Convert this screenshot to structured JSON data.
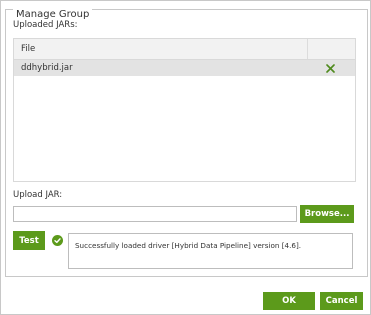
{
  "dialog": {
    "title": "Manage Group",
    "uploaded_label": "Uploaded JARs:",
    "table": {
      "columns": [
        "File",
        ""
      ],
      "rows": [
        {
          "file": "ddhybrid.jar",
          "action_icon": "delete-x-icon"
        }
      ]
    },
    "upload_label": "Upload JAR:",
    "upload_input": {
      "value": "",
      "placeholder": ""
    },
    "browse_label": "Browse...",
    "test_label": "Test",
    "status_icon": "success-check-icon",
    "status_message": "Successfully loaded driver [Hybrid Data Pipeline] version [4.6].",
    "ok_label": "OK",
    "cancel_label": "Cancel"
  },
  "colors": {
    "accent": "#5c9a1b",
    "delete_icon": "#4f8a1d",
    "row_selected": "#e3e3e3",
    "header_bg": "#f2f2f2"
  }
}
